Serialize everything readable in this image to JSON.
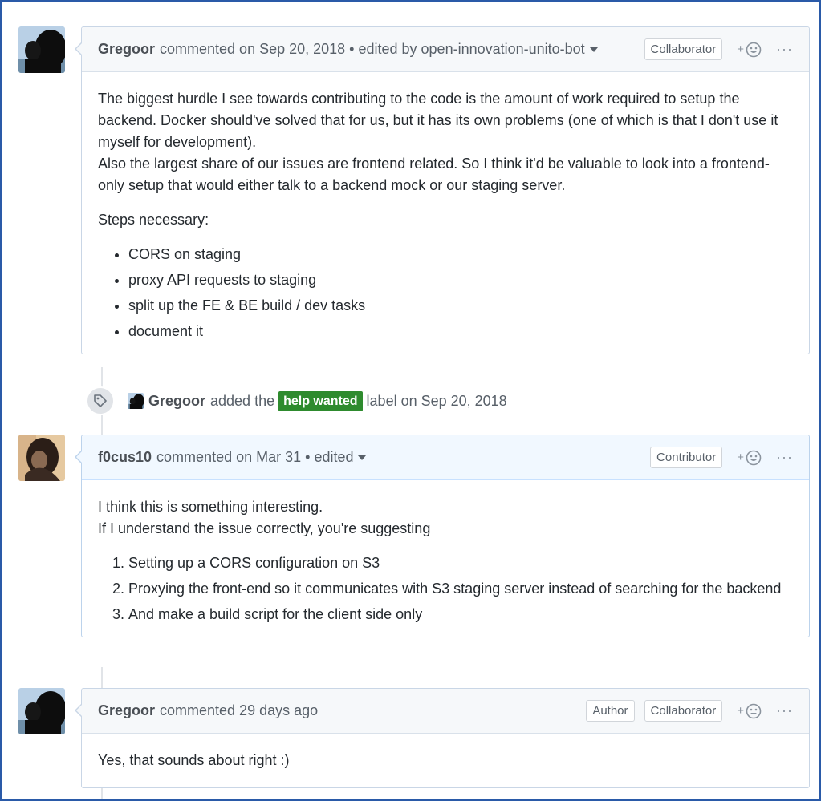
{
  "comments": [
    {
      "author": "Gregoor",
      "meta": "commented on Sep 20, 2018 • edited by open-innovation-unito-bot",
      "roles": [
        "Collaborator"
      ],
      "paragraphs": [
        "The biggest hurdle I see towards contributing to the code is the amount of work required to setup the backend. Docker should've solved that for us, but it has its own problems (one of which is that I don't use it myself for development).\nAlso the largest share of our issues are frontend related. So I think it'd be valuable to look into a frontend-only setup that would either talk to a backend mock or our staging server.",
        "Steps necessary:"
      ],
      "list_type": "ul",
      "list": [
        "CORS on staging",
        "proxy API requests to staging",
        "split up the FE & BE build / dev tasks",
        "document it"
      ]
    },
    {
      "author": "f0cus10",
      "meta": "commented on Mar 31 • edited",
      "roles": [
        "Contributor"
      ],
      "paragraphs": [
        "I think this is something interesting.\nIf I understand the issue correctly, you're suggesting"
      ],
      "list_type": "ol",
      "list": [
        "Setting up a CORS configuration on S3",
        "Proxying the front-end so it communicates with S3 staging server instead of searching for the backend",
        "And make a build script for the client side only"
      ]
    },
    {
      "author": "Gregoor",
      "meta": "commented 29 days ago",
      "roles": [
        "Author",
        "Collaborator"
      ],
      "paragraphs": [
        "Yes, that sounds about right :)"
      ],
      "list_type": "",
      "list": []
    }
  ],
  "event": {
    "author": "Gregoor",
    "text_before": "added the",
    "label": "help wanted",
    "text_after": "label on Sep 20, 2018",
    "icon": "tag-icon"
  },
  "reaction": {
    "plus": "+",
    "icon": "smiley-icon"
  },
  "more": "···",
  "colors": {
    "label_bg": "#2e8b2e",
    "frame": "#2a5aa8",
    "header_bg": "#f6f8fa",
    "highlight_header_bg": "#f1f8ff"
  }
}
